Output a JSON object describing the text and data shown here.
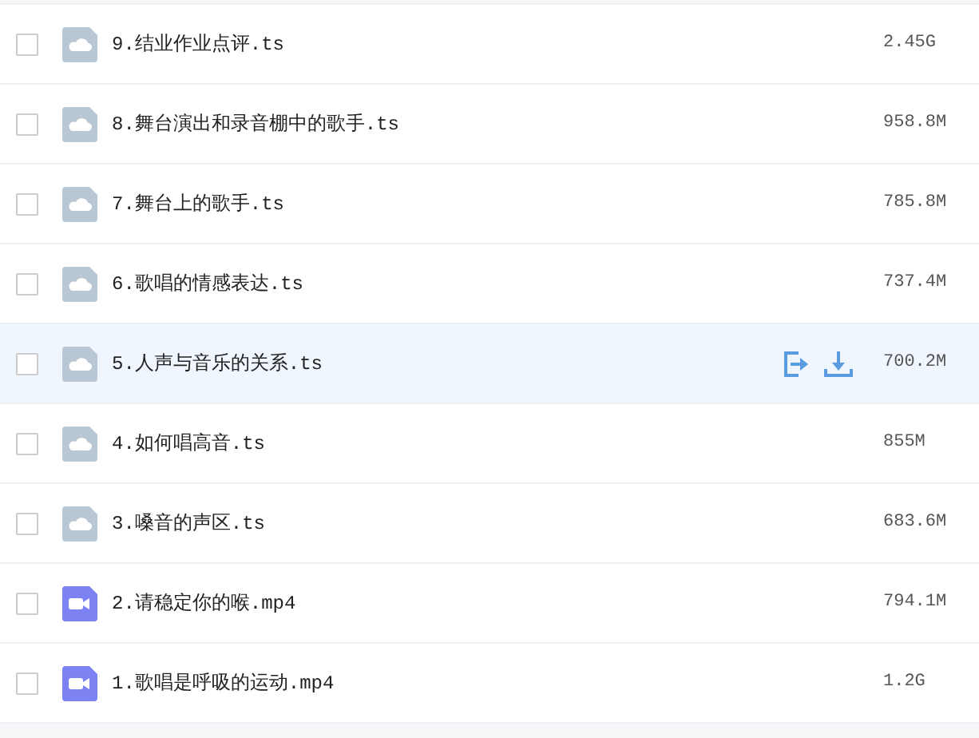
{
  "files": [
    {
      "name": "9.结业作业点评.ts",
      "size": "2.45G",
      "kind": "cloud",
      "checked": false,
      "hovered": false
    },
    {
      "name": "8.舞台演出和录音棚中的歌手.ts",
      "size": "958.8M",
      "kind": "cloud",
      "checked": false,
      "hovered": false
    },
    {
      "name": "7.舞台上的歌手.ts",
      "size": "785.8M",
      "kind": "cloud",
      "checked": false,
      "hovered": false
    },
    {
      "name": "6.歌唱的情感表达.ts",
      "size": "737.4M",
      "kind": "cloud",
      "checked": false,
      "hovered": false
    },
    {
      "name": "5.人声与音乐的关系.ts",
      "size": "700.2M",
      "kind": "cloud",
      "checked": false,
      "hovered": true
    },
    {
      "name": "4.如何唱高音.ts",
      "size": "855M",
      "kind": "cloud",
      "checked": false,
      "hovered": false
    },
    {
      "name": "3.嗓音的声区.ts",
      "size": "683.6M",
      "kind": "cloud",
      "checked": false,
      "hovered": false
    },
    {
      "name": "2.请稳定你的喉.mp4",
      "size": "794.1M",
      "kind": "video",
      "checked": false,
      "hovered": false
    },
    {
      "name": "1.歌唱是呼吸的运动.mp4",
      "size": "1.2G",
      "kind": "video",
      "checked": false,
      "hovered": false
    }
  ]
}
